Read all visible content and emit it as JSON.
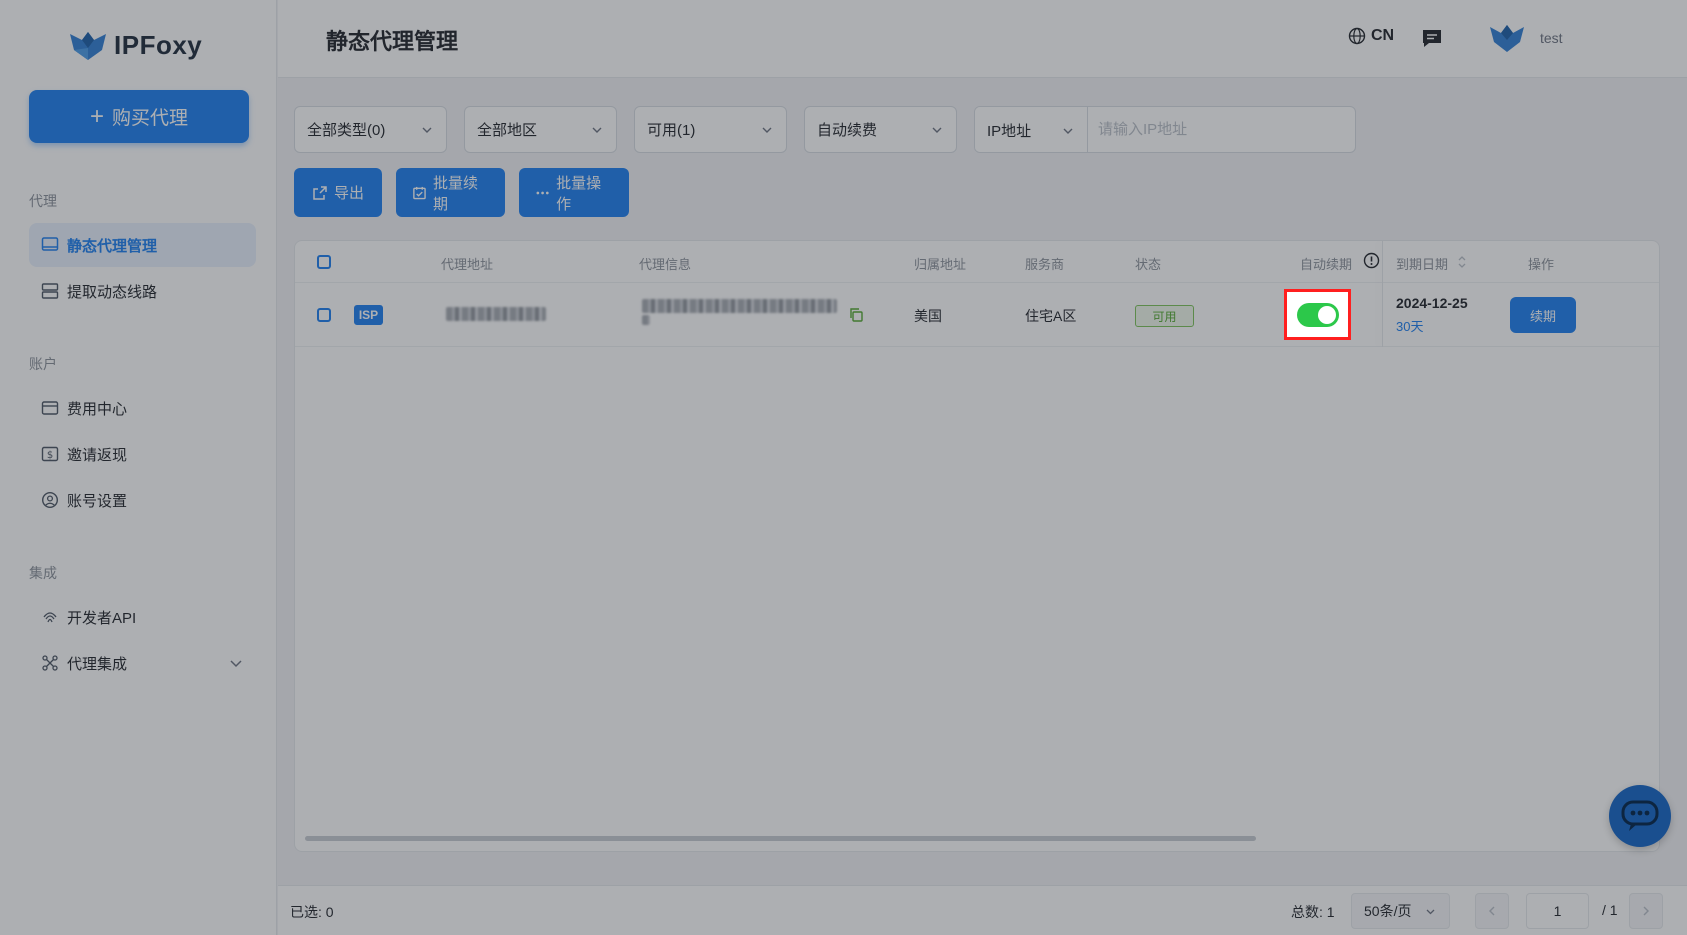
{
  "app": {
    "logo_text": "IPFoxy"
  },
  "sidebar": {
    "buy_label": "购买代理",
    "sections": [
      {
        "title": "代理"
      },
      {
        "title": "账户"
      },
      {
        "title": "集成"
      }
    ],
    "items": [
      {
        "label": "静态代理管理",
        "icon": "monitor-icon"
      },
      {
        "label": "提取动态线路",
        "icon": "server-icon"
      },
      {
        "label": "费用中心",
        "icon": "billing-icon"
      },
      {
        "label": "邀请返现",
        "icon": "dollar-icon"
      },
      {
        "label": "账号设置",
        "icon": "user-circle-icon"
      },
      {
        "label": "开发者API",
        "icon": "fingerprint-icon"
      },
      {
        "label": "代理集成",
        "icon": "network-icon"
      }
    ]
  },
  "header": {
    "title": "静态代理管理",
    "lang": "CN",
    "username": "test"
  },
  "filters": {
    "type": "全部类型(0)",
    "region": "全部地区",
    "status": "可用(1)",
    "renew": "自动续费",
    "ip_mode": "IP地址",
    "ip_placeholder": "请输入IP地址"
  },
  "actions": {
    "export": "导出",
    "batch_renew": "批量续期",
    "batch_ops": "批量操作"
  },
  "table": {
    "headers": {
      "addr": "代理地址",
      "info": "代理信息",
      "location": "归属地址",
      "provider": "服务商",
      "status": "状态",
      "auto_renew": "自动续期",
      "expire": "到期日期",
      "ops": "操作"
    },
    "rows": [
      {
        "tag": "ISP",
        "location": "美国",
        "provider": "住宅A区",
        "status": "可用",
        "auto_renew": true,
        "expire_date": "2024-12-25",
        "expire_days": "30天",
        "op_label": "续期"
      }
    ]
  },
  "footer": {
    "selected": "已选: 0",
    "total": "总数: 1",
    "page_size": "50条/页",
    "page": "1",
    "page_total": "/ 1"
  },
  "colors": {
    "primary": "#1c7ff0",
    "switch_on": "#2cc84a",
    "highlight": "#ff1f1f",
    "status_green": "#52a82e"
  }
}
